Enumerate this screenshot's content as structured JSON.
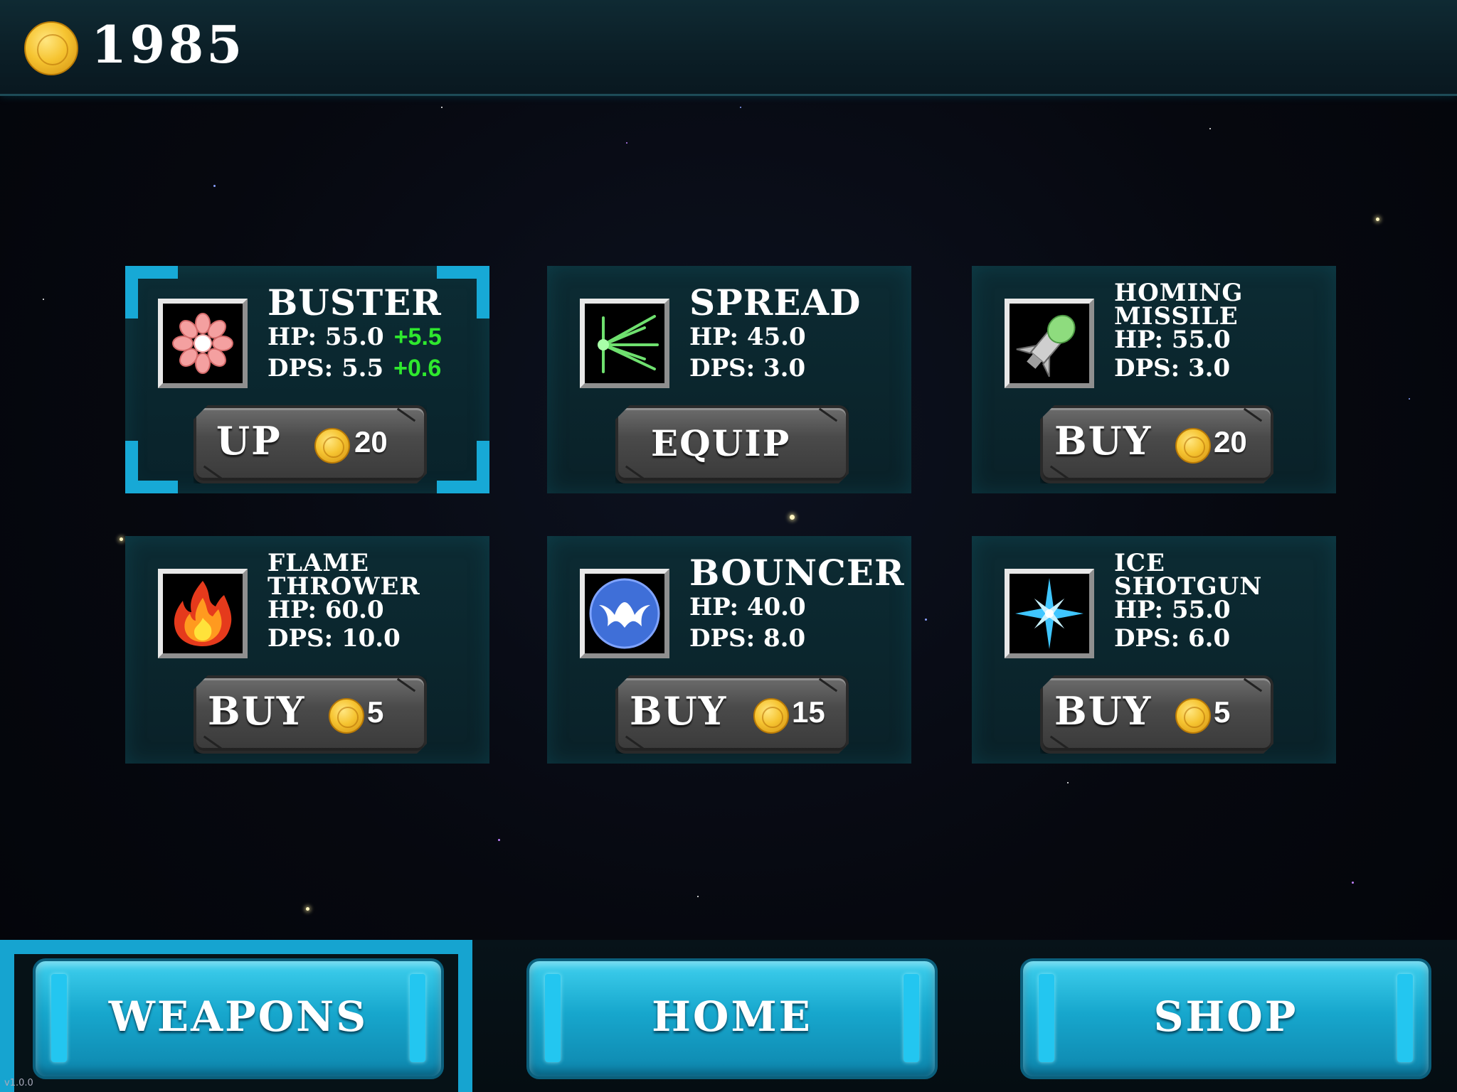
{
  "header": {
    "coins": "1985"
  },
  "weapons": [
    {
      "name": "BUSTER",
      "hp": "HP: 55.0",
      "hp_bonus": "+5.5",
      "dps": "DPS: 5.5",
      "dps_bonus": "+0.6",
      "action": "UP",
      "price": "20",
      "icon": "flower-icon",
      "selected": true
    },
    {
      "name": "SPREAD",
      "hp": "HP: 45.0",
      "dps": "DPS: 3.0",
      "action": "EQUIP",
      "icon": "spread-icon"
    },
    {
      "name_line1": "HOMING",
      "name_line2": "MISSILE",
      "hp": "HP: 55.0",
      "dps": "DPS: 3.0",
      "action": "BUY",
      "price": "20",
      "icon": "missile-icon"
    },
    {
      "name_line1": "FLAME",
      "name_line2": "THROWER",
      "hp": "HP: 60.0",
      "dps": "DPS: 10.0",
      "action": "BUY",
      "price": "5",
      "icon": "flame-icon"
    },
    {
      "name": "BOUNCER",
      "hp": "HP: 40.0",
      "dps": "DPS: 8.0",
      "action": "BUY",
      "price": "15",
      "icon": "bouncer-icon"
    },
    {
      "name_line1": "ICE",
      "name_line2": "SHOTGUN",
      "hp": "HP: 55.0",
      "dps": "DPS: 6.0",
      "action": "BUY",
      "price": "5",
      "icon": "ice-star-icon"
    }
  ],
  "nav": {
    "weapons": "WEAPONS",
    "home": "HOME",
    "shop": "SHOP",
    "active": "weapons"
  },
  "version": "v1.0.0",
  "colors": {
    "accent": "#16a4d0",
    "bonus": "#2ee82e",
    "coin": "#f6c431"
  }
}
